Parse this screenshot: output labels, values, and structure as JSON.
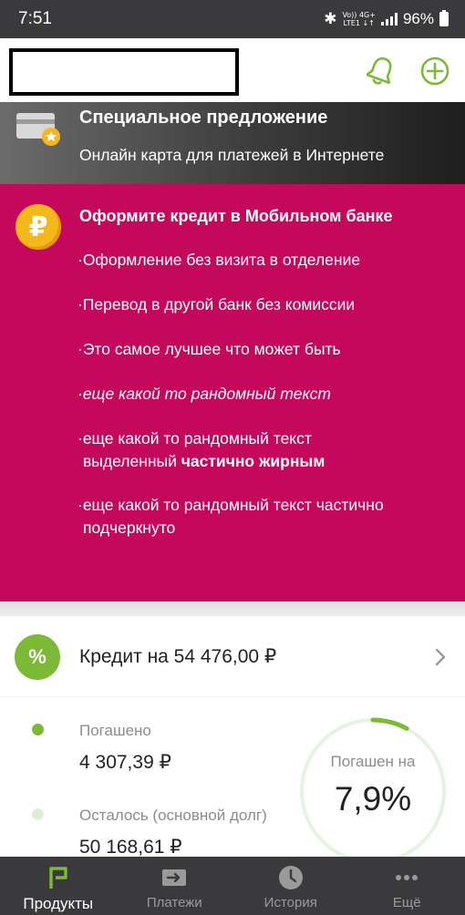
{
  "status_bar": {
    "time": "7:51",
    "network_top": "Vo)) 4G+",
    "network_bottom": "LTE1 ↓↑",
    "battery": "96%"
  },
  "header": {
    "icons": [
      "bell-icon",
      "add-circle-icon"
    ],
    "accent": "#7cb936"
  },
  "special_offer": {
    "title": "Специальное предложение",
    "subtitle": "Онлайн карта для платежей в Интернете",
    "icon": "card-star-icon"
  },
  "promo": {
    "title": "Оформите кредит в Мобильном банке",
    "icon": "ruble-coin-icon",
    "coin_symbol": "₽",
    "bg_color": "#c4085c",
    "items": [
      {
        "text": "·Оформление без визита в отделение"
      },
      {
        "text": "·Перевод в другой банк без комиссии"
      },
      {
        "text": "·Это самое лучшее что может быть"
      },
      {
        "text": "·еще какой то рандомный текст"
      },
      {
        "line1": "·еще какой то рандомный текст",
        "line2_regular": "выделенный ",
        "line2_bold": "частично жирным"
      },
      {
        "line1": "·еще какой то рандомный текст частично",
        "line2": "подчеркнуто"
      }
    ]
  },
  "credit": {
    "icon_symbol": "%",
    "title": "Кредит на 54 476,00 ₽",
    "paid_label": "Погашено",
    "paid_value": "4 307,39 ₽",
    "remaining_label": "Осталось (основной долг)",
    "remaining_value": "50 168,61 ₽",
    "ring_label": "Погашен на",
    "ring_value": "7,9%",
    "paid_fraction": 0.079,
    "paid_color": "#7cb936",
    "remaining_color": "#dcefd6"
  },
  "bottom_nav": {
    "items": [
      {
        "label": "Продукты",
        "icon": "products-logo-icon",
        "active": true
      },
      {
        "label": "Платежи",
        "icon": "payments-arrow-icon",
        "active": false
      },
      {
        "label": "История",
        "icon": "history-clock-icon",
        "active": false
      },
      {
        "label": "Ещё",
        "icon": "more-dots-icon",
        "active": false
      }
    ]
  }
}
